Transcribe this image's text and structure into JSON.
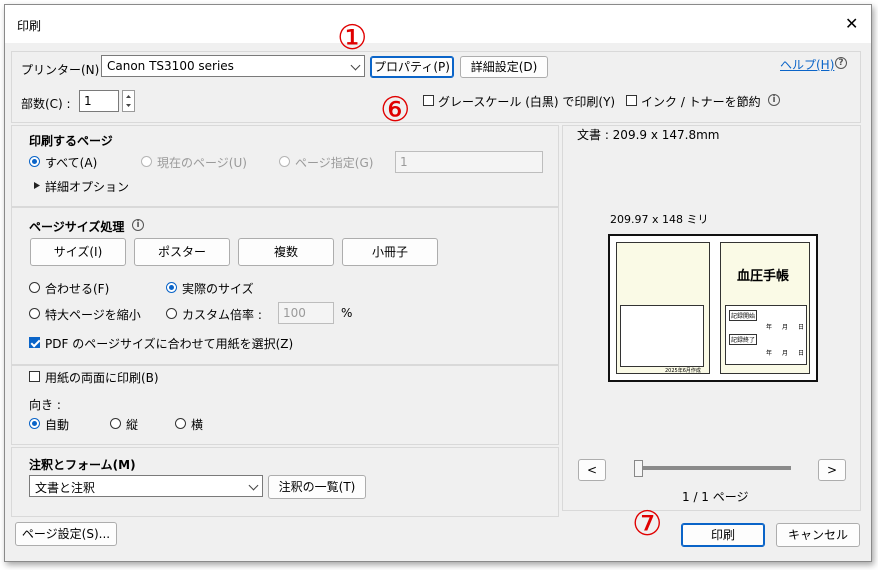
{
  "window": {
    "title": "印刷",
    "close_glyph": "✕"
  },
  "printer": {
    "label": "プリンター(N) :",
    "selected": "Canon TS3100 series",
    "properties_button": "プロパティ(P)",
    "advanced_button": "詳細設定(D)",
    "help_link": "ヘルプ(H)",
    "help_icon": "?"
  },
  "copies": {
    "label": "部数(C) :",
    "value": "1"
  },
  "options": {
    "grayscale": "グレースケール (白黒) で印刷(Y)",
    "save_ink": "インク / トナーを節約",
    "info_icon": "i"
  },
  "pages": {
    "heading": "印刷するページ",
    "all": "すべて(A)",
    "current": "現在のページ(U)",
    "range": "ページ指定(G)",
    "range_value": "1",
    "more_options": "詳細オプション"
  },
  "sizing": {
    "heading": "ページサイズ処理",
    "info_icon": "i",
    "tabs": [
      "サイズ(I)",
      "ポスター",
      "複数",
      "小冊子"
    ],
    "fit": "合わせる(F)",
    "actual": "実際のサイズ",
    "shrink": "特大ページを縮小",
    "custom": "カスタム倍率 :",
    "custom_value": "100",
    "percent": "%",
    "pdf_paper": "PDF のページサイズに合わせて用紙を選択(Z)"
  },
  "duplex": {
    "label": "用紙の両面に印刷(B)"
  },
  "orientation": {
    "heading": "向き :",
    "auto": "自動",
    "portrait": "縦",
    "landscape": "横"
  },
  "comments": {
    "heading": "注釈とフォーム(M)",
    "selected": "文書と注釈",
    "summary_button": "注釈の一覧(T)"
  },
  "preview": {
    "doc_size": "文書 : 209.9 x 147.8mm",
    "paper_size": "209.97 x 148 ミリ",
    "page_title": "血圧手帳",
    "start_label": "記録開始",
    "end_label": "記録終了",
    "year": "年",
    "month": "月",
    "day": "日",
    "footer_note": "2025年6月作成",
    "page_indicator": "1 / 1 ページ",
    "prev": "<",
    "next": ">",
    "zoom_level": 0.0
  },
  "footer": {
    "page_setup": "ページ設定(S)...",
    "print": "印刷",
    "cancel": "キャンセル"
  },
  "annotations": {
    "one": "①",
    "six": "⑥",
    "seven": "⑦"
  },
  "colors": {
    "accent": "#0a64c8",
    "annotation": "#e00000",
    "preview_fill": "#fafae6"
  }
}
